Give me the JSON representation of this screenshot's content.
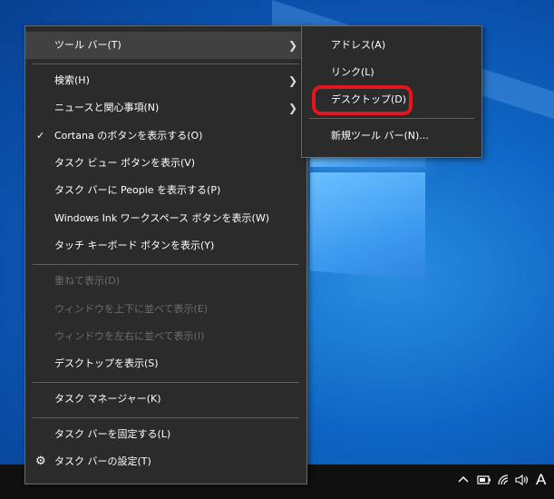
{
  "context_menu": {
    "items": [
      {
        "label": "ツール バー(T)",
        "submenu": true
      },
      {
        "label": "検索(H)",
        "submenu": true
      },
      {
        "label": "ニュースと関心事項(N)",
        "submenu": true
      },
      {
        "label": "Cortana のボタンを表示する(O)",
        "checked": true
      },
      {
        "label": "タスク ビュー ボタンを表示(V)"
      },
      {
        "label": "タスク バーに People を表示する(P)"
      },
      {
        "label": "Windows Ink ワークスペース ボタンを表示(W)"
      },
      {
        "label": "タッチ キーボード ボタンを表示(Y)"
      },
      {
        "label": "重ねて表示(D)",
        "disabled": true
      },
      {
        "label": "ウィンドウを上下に並べて表示(E)",
        "disabled": true
      },
      {
        "label": "ウィンドウを左右に並べて表示(I)",
        "disabled": true
      },
      {
        "label": "デスクトップを表示(S)"
      },
      {
        "label": "タスク マネージャー(K)"
      },
      {
        "label": "タスク バーを固定する(L)"
      },
      {
        "label": "タスク バーの設定(T)",
        "icon": "gear-icon"
      }
    ]
  },
  "toolbar_submenu": {
    "items": [
      {
        "label": "アドレス(A)"
      },
      {
        "label": "リンク(L)"
      },
      {
        "label": "デスクトップ(D)"
      },
      {
        "label": "新規ツール バー(N)..."
      }
    ]
  },
  "tray": {
    "ime_indicator": "A",
    "icons": [
      "chevron-up-icon",
      "battery-icon",
      "wifi-icon",
      "speaker-icon"
    ]
  },
  "colors": {
    "menu_bg": "#2b2b2b",
    "highlight": "#e2161e",
    "taskbar": "#101010"
  }
}
